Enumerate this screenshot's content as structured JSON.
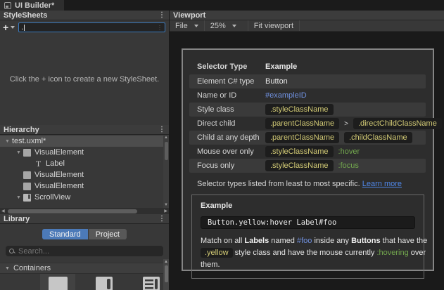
{
  "titlebar": {
    "tab_label": "UI Builder*"
  },
  "stylesheets": {
    "panel_title": "StyleSheets",
    "add_button": "+",
    "selector_input_value": ".",
    "empty_message": "Click the + icon to create a new StyleSheet."
  },
  "hierarchy": {
    "panel_title": "Hierarchy",
    "items": [
      {
        "label": "test.uxml*",
        "depth": 0,
        "expanded": true,
        "icon": "none",
        "selected": true
      },
      {
        "label": "VisualElement",
        "depth": 1,
        "expanded": true,
        "icon": "visual-element",
        "selected": false
      },
      {
        "label": "Label",
        "depth": 2,
        "expanded": false,
        "icon": "label",
        "selected": false
      },
      {
        "label": "VisualElement",
        "depth": 1,
        "expanded": false,
        "icon": "visual-element",
        "selected": false
      },
      {
        "label": "VisualElement",
        "depth": 1,
        "expanded": false,
        "icon": "visual-element",
        "selected": false
      },
      {
        "label": "ScrollView",
        "depth": 1,
        "expanded": true,
        "icon": "scroll-view",
        "selected": false
      }
    ]
  },
  "library": {
    "panel_title": "Library",
    "tabs": [
      {
        "label": "Standard",
        "active": true
      },
      {
        "label": "Project",
        "active": false
      }
    ],
    "search_placeholder": "Search...",
    "section_title": "Containers",
    "items": [
      {
        "name": "VisualElement",
        "icon": "visual-element"
      },
      {
        "name": "ScrollView",
        "icon": "scroll-view"
      },
      {
        "name": "ListView",
        "icon": "list-view"
      }
    ]
  },
  "viewport": {
    "panel_title": "Viewport",
    "toolbar": {
      "file_menu": "File",
      "zoom_level": "25%",
      "fit_button": "Fit viewport"
    }
  },
  "selector_help": {
    "table": {
      "col_type": "Selector Type",
      "col_example": "Example",
      "rows": [
        {
          "type": "Element C# type",
          "example": [
            {
              "text": "Button",
              "style": "plain"
            }
          ]
        },
        {
          "type": "Name or ID",
          "example": [
            {
              "text": "#exampleID",
              "style": "id"
            }
          ]
        },
        {
          "type": "Style class",
          "example": [
            {
              "text": ".styleClassName",
              "style": "pill"
            }
          ]
        },
        {
          "type": "Direct child",
          "example": [
            {
              "text": ".parentClassName",
              "style": "pill"
            },
            {
              "text": ">",
              "style": "sep"
            },
            {
              "text": ".directChildClassName",
              "style": "pill"
            }
          ]
        },
        {
          "type": "Child at any depth",
          "example": [
            {
              "text": ".parentClassName",
              "style": "pill"
            },
            {
              "text": ".childClassName",
              "style": "pill"
            }
          ]
        },
        {
          "type": "Mouse over only",
          "example": [
            {
              "text": ".styleClassName",
              "style": "pill"
            },
            {
              "text": ":hover",
              "style": "pseudo"
            }
          ]
        },
        {
          "type": "Focus only",
          "example": [
            {
              "text": ".styleClassName",
              "style": "pill"
            },
            {
              "text": ":focus",
              "style": "pseudo"
            }
          ]
        }
      ]
    },
    "note_text": "Selector types listed from least to most specific.",
    "learn_more_label": "Learn more",
    "example_title": "Example",
    "example_code": "Button.yellow:hover Label#foo",
    "description_segments": [
      {
        "text": "Match on all ",
        "style": "plain"
      },
      {
        "text": "Labels",
        "style": "bold"
      },
      {
        "text": " named ",
        "style": "plain"
      },
      {
        "text": "#foo",
        "style": "id"
      },
      {
        "text": " inside any ",
        "style": "plain"
      },
      {
        "text": "Buttons",
        "style": "bold"
      },
      {
        "text": " that have the ",
        "style": "plain"
      },
      {
        "text": ".yellow",
        "style": "pill"
      },
      {
        "text": " style class and have the mouse currently ",
        "style": "plain"
      },
      {
        "text": ":hovering",
        "style": "pseudo"
      },
      {
        "text": " over them.",
        "style": "plain"
      }
    ]
  },
  "colors": {
    "focus_border": "#3a79bb",
    "tab_active": "#4c7ab8",
    "class_yellow": "#d4cc76",
    "pseudo_green": "#73a84e",
    "id_blue": "#7091e0",
    "link_blue": "#4f87e8"
  }
}
